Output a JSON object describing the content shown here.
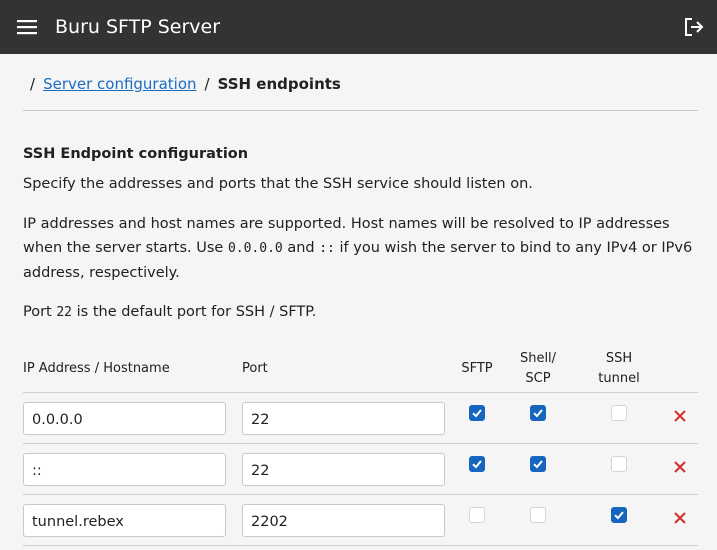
{
  "app": {
    "title": "Buru SFTP Server"
  },
  "breadcrumb": {
    "sep": "/",
    "parent": "Server configuration",
    "current": "SSH endpoints"
  },
  "section": {
    "title": "SSH Endpoint configuration",
    "p1": "Specify the addresses and ports that the SSH service should listen on.",
    "p2_a": "IP addresses and host names are supported. Host names will be resolved to IP addresses when the server starts. Use ",
    "p2_code1": "0.0.0.0",
    "p2_b": " and ",
    "p2_code2": "::",
    "p2_c": " if you wish the server to bind to any IPv4 or IPv6 address, respectively.",
    "p3_a": "Port ",
    "p3_code": "22",
    "p3_b": " is the default port for SSH / SFTP."
  },
  "table": {
    "headers": {
      "host": "IP Address / Hostname",
      "port": "Port",
      "sftp": "SFTP",
      "shell_1": "Shell/",
      "shell_2": "SCP",
      "tunnel_1": "SSH",
      "tunnel_2": "tunnel"
    },
    "rows": [
      {
        "host": "0.0.0.0",
        "port": "22",
        "sftp": true,
        "shell": true,
        "tunnel": false
      },
      {
        "host": "::",
        "port": "22",
        "sftp": true,
        "shell": true,
        "tunnel": false
      },
      {
        "host": "tunnel.rebex",
        "port": "2202",
        "sftp": false,
        "shell": false,
        "tunnel": true
      }
    ]
  },
  "colors": {
    "topbar": "#333333",
    "link": "#1a6dc2",
    "checkbox": "#1666bf",
    "delete": "#d32f2f"
  },
  "icons": {
    "menu": "hamburger-icon",
    "logout": "logout-icon",
    "delete": "close-x-icon",
    "check": "checkmark-icon"
  }
}
